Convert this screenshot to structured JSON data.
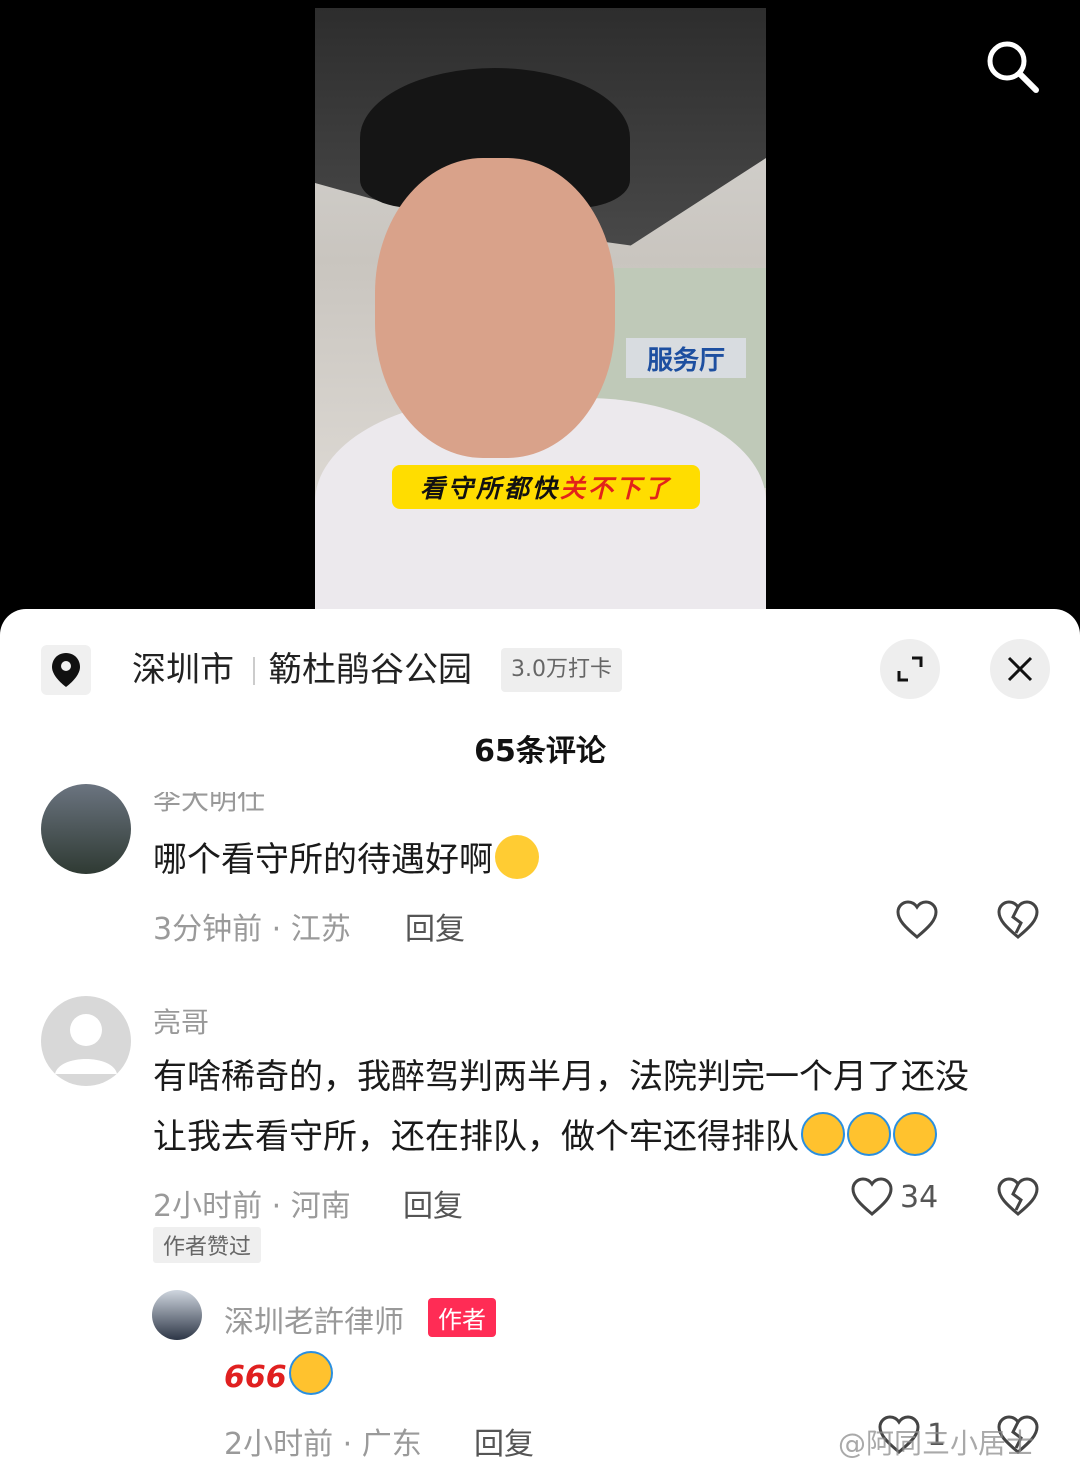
{
  "video": {
    "caption_part1": "看守所都快",
    "caption_part2": "关不下了",
    "building_sign": "服务厅"
  },
  "location": {
    "city": "深圳市",
    "place": "簕杜鹃谷公园",
    "checkins": "3.0万打卡"
  },
  "comments_header": "65条评论",
  "comments": [
    {
      "name": "李大明仕",
      "text": "哪个看守所的待遇好啊",
      "time_region": "3分钟前 · 江苏",
      "reply": "回复",
      "likes": ""
    },
    {
      "name": "亮哥",
      "text_line1": "有啥稀奇的，我醉驾判两半月，法院判完一个月了还没",
      "text_line2": "让我去看守所，还在排队，做个牢还得排队",
      "time_region": "2小时前 · 河南",
      "reply": "回复",
      "likes": "34",
      "author_liked": "作者赞过"
    }
  ],
  "sub_reply": {
    "name": "深圳老許律师",
    "badge": "作者",
    "text": "666",
    "time_region": "2小时前 · 广东",
    "reply": "回复",
    "likes": "1"
  },
  "watermark": "@阿同三小居士"
}
